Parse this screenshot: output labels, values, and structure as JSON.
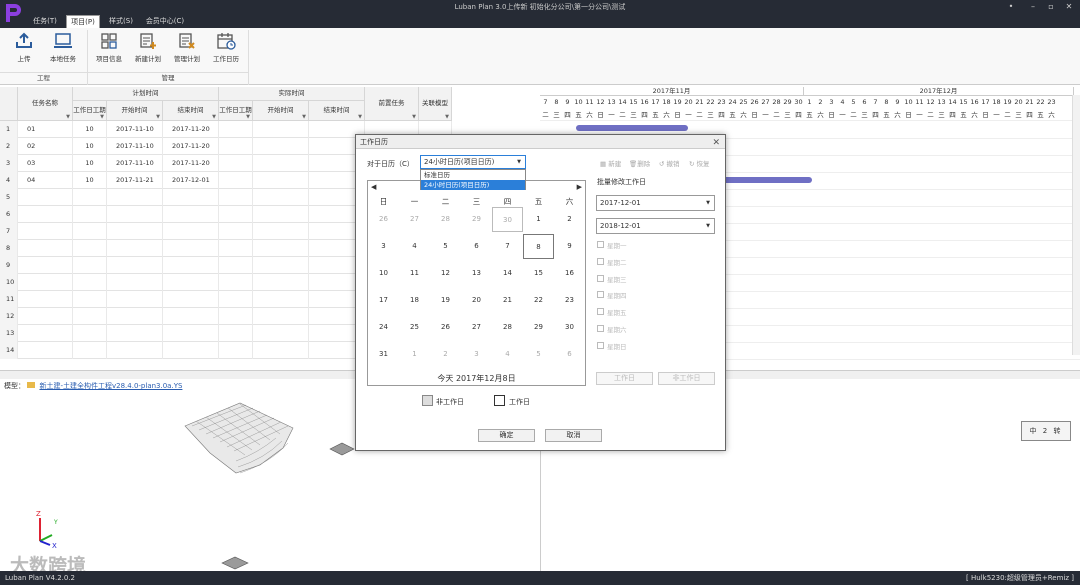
{
  "window": {
    "title": "Luban Plan 3.0上传新 初始化分公司\\第一分公司\\测试",
    "controls": [
      "•",
      "–",
      "▫",
      "✕"
    ]
  },
  "menu": {
    "tabs": [
      "任务(T)",
      "项目(P)",
      "样式(S)",
      "会员中心(C)"
    ],
    "active": 1
  },
  "ribbon": {
    "buttons": [
      "上传",
      "本地任务",
      "项目信息",
      "新建计划",
      "管理计划",
      "工作日历"
    ],
    "groups": [
      "工程",
      "管理"
    ]
  },
  "grid": {
    "headers": {
      "task_name": "任务名称",
      "planned_time": "计划时间",
      "actual_time": "实际时间",
      "planned_workdays": "工作日工期",
      "planned_start": "开始时间",
      "planned_end": "结束时间",
      "actual_workdays": "工作日工期",
      "actual_start": "开始时间",
      "actual_end": "结束时间",
      "predecessor": "前置任务",
      "linked_model": "关联模型"
    },
    "rows": [
      {
        "num": "1",
        "name": "01",
        "workdays": "10",
        "start": "2017-11-10",
        "end": "2017-11-20"
      },
      {
        "num": "2",
        "name": "02",
        "workdays": "10",
        "start": "2017-11-10",
        "end": "2017-11-20"
      },
      {
        "num": "3",
        "name": "03",
        "workdays": "10",
        "start": "2017-11-10",
        "end": "2017-11-20"
      },
      {
        "num": "4",
        "name": "04",
        "workdays": "10",
        "start": "2017-11-21",
        "end": "2017-12-01"
      },
      {
        "num": "5"
      },
      {
        "num": "6"
      },
      {
        "num": "7"
      },
      {
        "num": "8"
      },
      {
        "num": "9"
      },
      {
        "num": "10"
      },
      {
        "num": "11"
      },
      {
        "num": "12"
      },
      {
        "num": "13"
      },
      {
        "num": "14"
      }
    ]
  },
  "gantt": {
    "months": [
      "2017年11月",
      "2017年12月"
    ],
    "days": [
      "7",
      "8",
      "9",
      "10",
      "11",
      "12",
      "13",
      "14",
      "15",
      "16",
      "17",
      "18",
      "19",
      "20",
      "21",
      "22",
      "23",
      "24",
      "25",
      "26",
      "27",
      "28",
      "29",
      "30",
      "1",
      "2",
      "3",
      "4",
      "5",
      "6",
      "7",
      "8",
      "9",
      "10",
      "11",
      "12",
      "13",
      "14",
      "15",
      "16",
      "17",
      "18",
      "19",
      "20",
      "21",
      "22",
      "23"
    ],
    "weekdays": [
      "二",
      "三",
      "四",
      "五",
      "六",
      "日",
      "一",
      "二",
      "三",
      "四",
      "五",
      "六",
      "日",
      "一",
      "二",
      "三",
      "四",
      "五",
      "六",
      "日",
      "一",
      "二",
      "三",
      "四",
      "五",
      "六",
      "日",
      "一",
      "二",
      "三",
      "四",
      "五",
      "六",
      "日",
      "一",
      "二",
      "三",
      "四",
      "五",
      "六",
      "日",
      "一",
      "二",
      "三",
      "四",
      "五",
      "六"
    ]
  },
  "model": {
    "label": "模型：",
    "file": "新土建-土建全构件工程v28.4.0-plan3.0a.YS",
    "stamp": "中 2 转"
  },
  "dialog": {
    "title": "工作日历",
    "close": "✕",
    "for_calendar_label": "对于日历（C）",
    "selected_calendar": "24小时日历(项目日历)",
    "calendar_options": [
      "标准日历",
      "24小时日历(项目日历)"
    ],
    "toolbar": [
      "新建",
      "删除",
      "撤销",
      "恢复"
    ],
    "weekday_headers": [
      "日",
      "一",
      "二",
      "三",
      "四",
      "五",
      "六"
    ],
    "calendar_days": [
      [
        "26",
        "27",
        "28",
        "29",
        "30",
        "1",
        "2"
      ],
      [
        "3",
        "4",
        "5",
        "6",
        "7",
        "8",
        "9"
      ],
      [
        "10",
        "11",
        "12",
        "13",
        "14",
        "15",
        "16"
      ],
      [
        "17",
        "18",
        "19",
        "20",
        "21",
        "22",
        "23"
      ],
      [
        "24",
        "25",
        "26",
        "27",
        "28",
        "29",
        "30"
      ],
      [
        "31",
        "1",
        "2",
        "3",
        "4",
        "5",
        "6"
      ]
    ],
    "today": "今天 2017年12月8日",
    "legend_non_workday": "非工作日",
    "legend_workday": "工作日",
    "batch_label": "批量修改工作日",
    "date_from": "2017-12-01",
    "date_to": "2018-12-01",
    "week_checks": [
      "星期一",
      "星期二",
      "星期三",
      "星期四",
      "星期五",
      "星期六",
      "星期日"
    ],
    "set_workday": "工作日",
    "set_non_workday": "非工作日",
    "ok": "确定",
    "cancel": "取消"
  },
  "status": {
    "version": "Luban Plan V4.2.0.2",
    "user": "[ Hulk5230:超级管理员+Remiz ]"
  },
  "watermark": "大数跨境",
  "colors": {
    "dark": "#262b35",
    "accent": "#2b7fd9",
    "gantt_bar": "#6f6fc4"
  }
}
